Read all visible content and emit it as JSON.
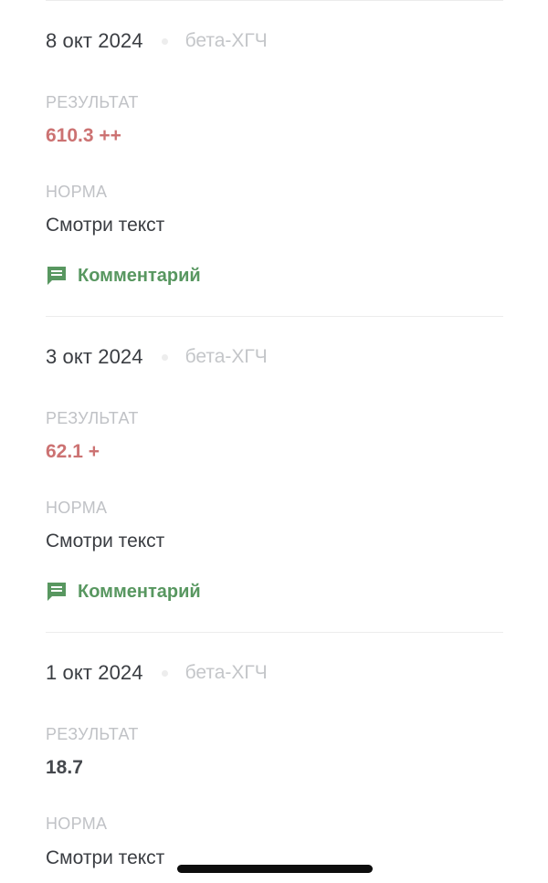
{
  "labels": {
    "result": "РЕЗУЛЬТАТ",
    "norm": "НОРМА",
    "comment": "Комментарий"
  },
  "entries": [
    {
      "date": "8 окт 2024",
      "test": "бета-ХГЧ",
      "result": "610.3 ++",
      "result_flagged": true,
      "norm": "Смотри текст",
      "has_comment": true
    },
    {
      "date": "3 окт 2024",
      "test": "бета-ХГЧ",
      "result": "62.1 +",
      "result_flagged": true,
      "norm": "Смотри текст",
      "has_comment": true
    },
    {
      "date": "1 окт 2024",
      "test": "бета-ХГЧ",
      "result": "18.7",
      "result_flagged": false,
      "norm": "Смотри текст",
      "has_comment": false
    }
  ],
  "colors": {
    "flagged_value": "#cc7272",
    "normal_value": "#45484d",
    "comment_accent": "#589760",
    "muted_label": "#c0c2c6",
    "divider": "#ececec"
  },
  "icons": {
    "comment": "comment-icon"
  }
}
